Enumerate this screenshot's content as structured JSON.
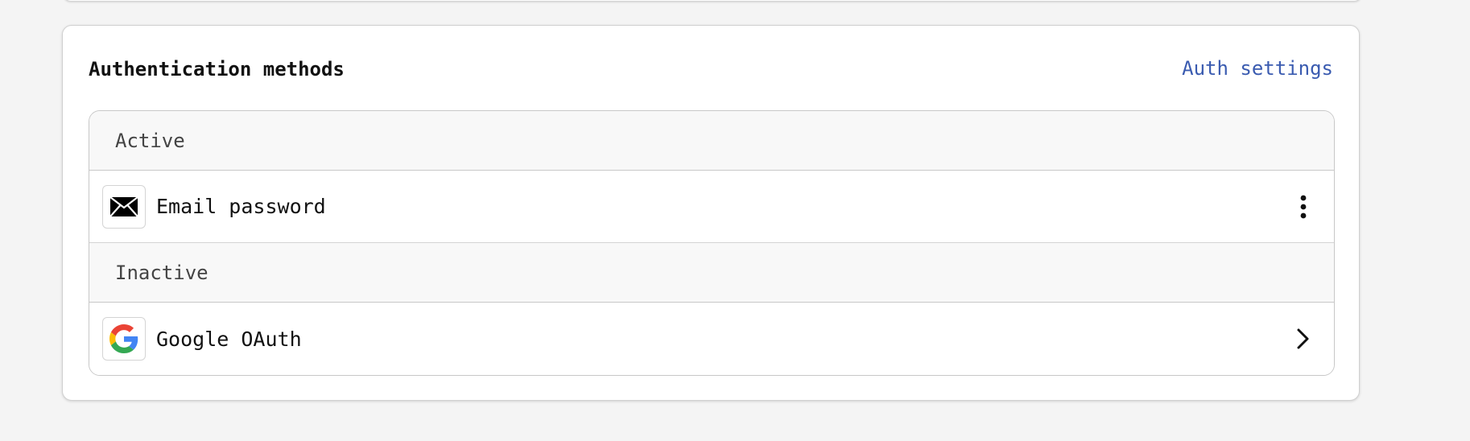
{
  "auth_methods_card": {
    "title": "Authentication methods",
    "settings_link_label": "Auth settings",
    "groups": [
      {
        "label": "Active",
        "methods": [
          {
            "label": "Email password",
            "icon": "envelope-icon",
            "action_icon": "more-vertical-icon"
          }
        ]
      },
      {
        "label": "Inactive",
        "methods": [
          {
            "label": "Google OAuth",
            "icon": "google-icon",
            "action_icon": "chevron-right-icon"
          }
        ]
      }
    ]
  },
  "colors": {
    "page_background": "#f4f4f4",
    "link": "#3a5bb0",
    "group_header_background": "#f8f8f8",
    "border": "#c8c8c8"
  }
}
